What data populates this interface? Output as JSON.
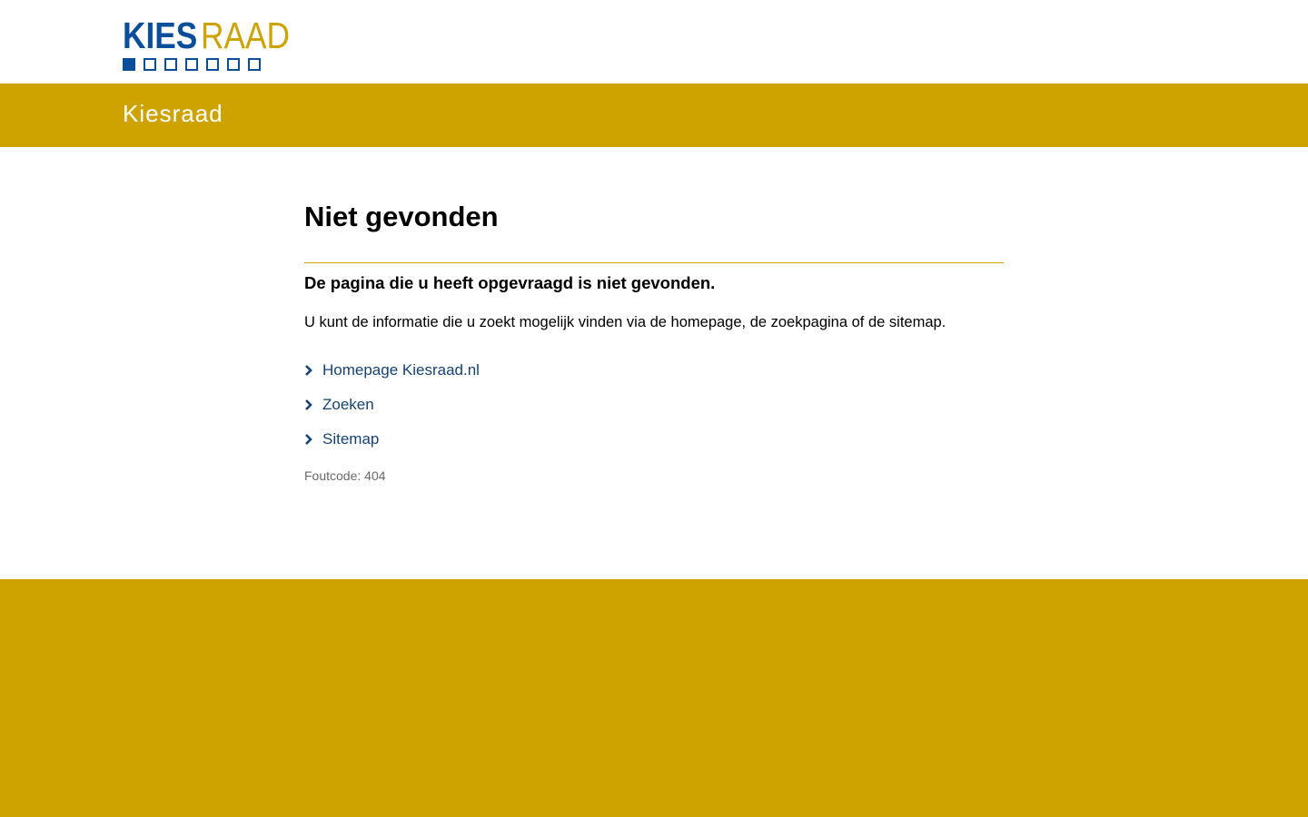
{
  "header": {
    "logo": {
      "part1": "KIES",
      "part2": "RAAD",
      "squares": [
        true,
        false,
        false,
        false,
        false,
        false,
        false
      ]
    }
  },
  "site_bar": {
    "title": "Kiesraad"
  },
  "main": {
    "title": "Niet gevonden",
    "intro": "De pagina die u heeft opgevraagd is niet gevonden.",
    "body": "U kunt de informatie die u zoekt mogelijk vinden via de homepage, de zoekpagina of de sitemap.",
    "links": [
      {
        "label": "Homepage Kiesraad.nl",
        "icon": "chevron-right-icon"
      },
      {
        "label": "Zoeken",
        "icon": "chevron-right-icon"
      },
      {
        "label": "Sitemap",
        "icon": "chevron-right-icon"
      }
    ],
    "error_code": "Foutcode: 404"
  },
  "colors": {
    "brand_blue": "#154273",
    "logo_blue": "#0a4e9b",
    "brand_yellow": "#cea300",
    "text": "#000000",
    "muted": "#696969"
  }
}
